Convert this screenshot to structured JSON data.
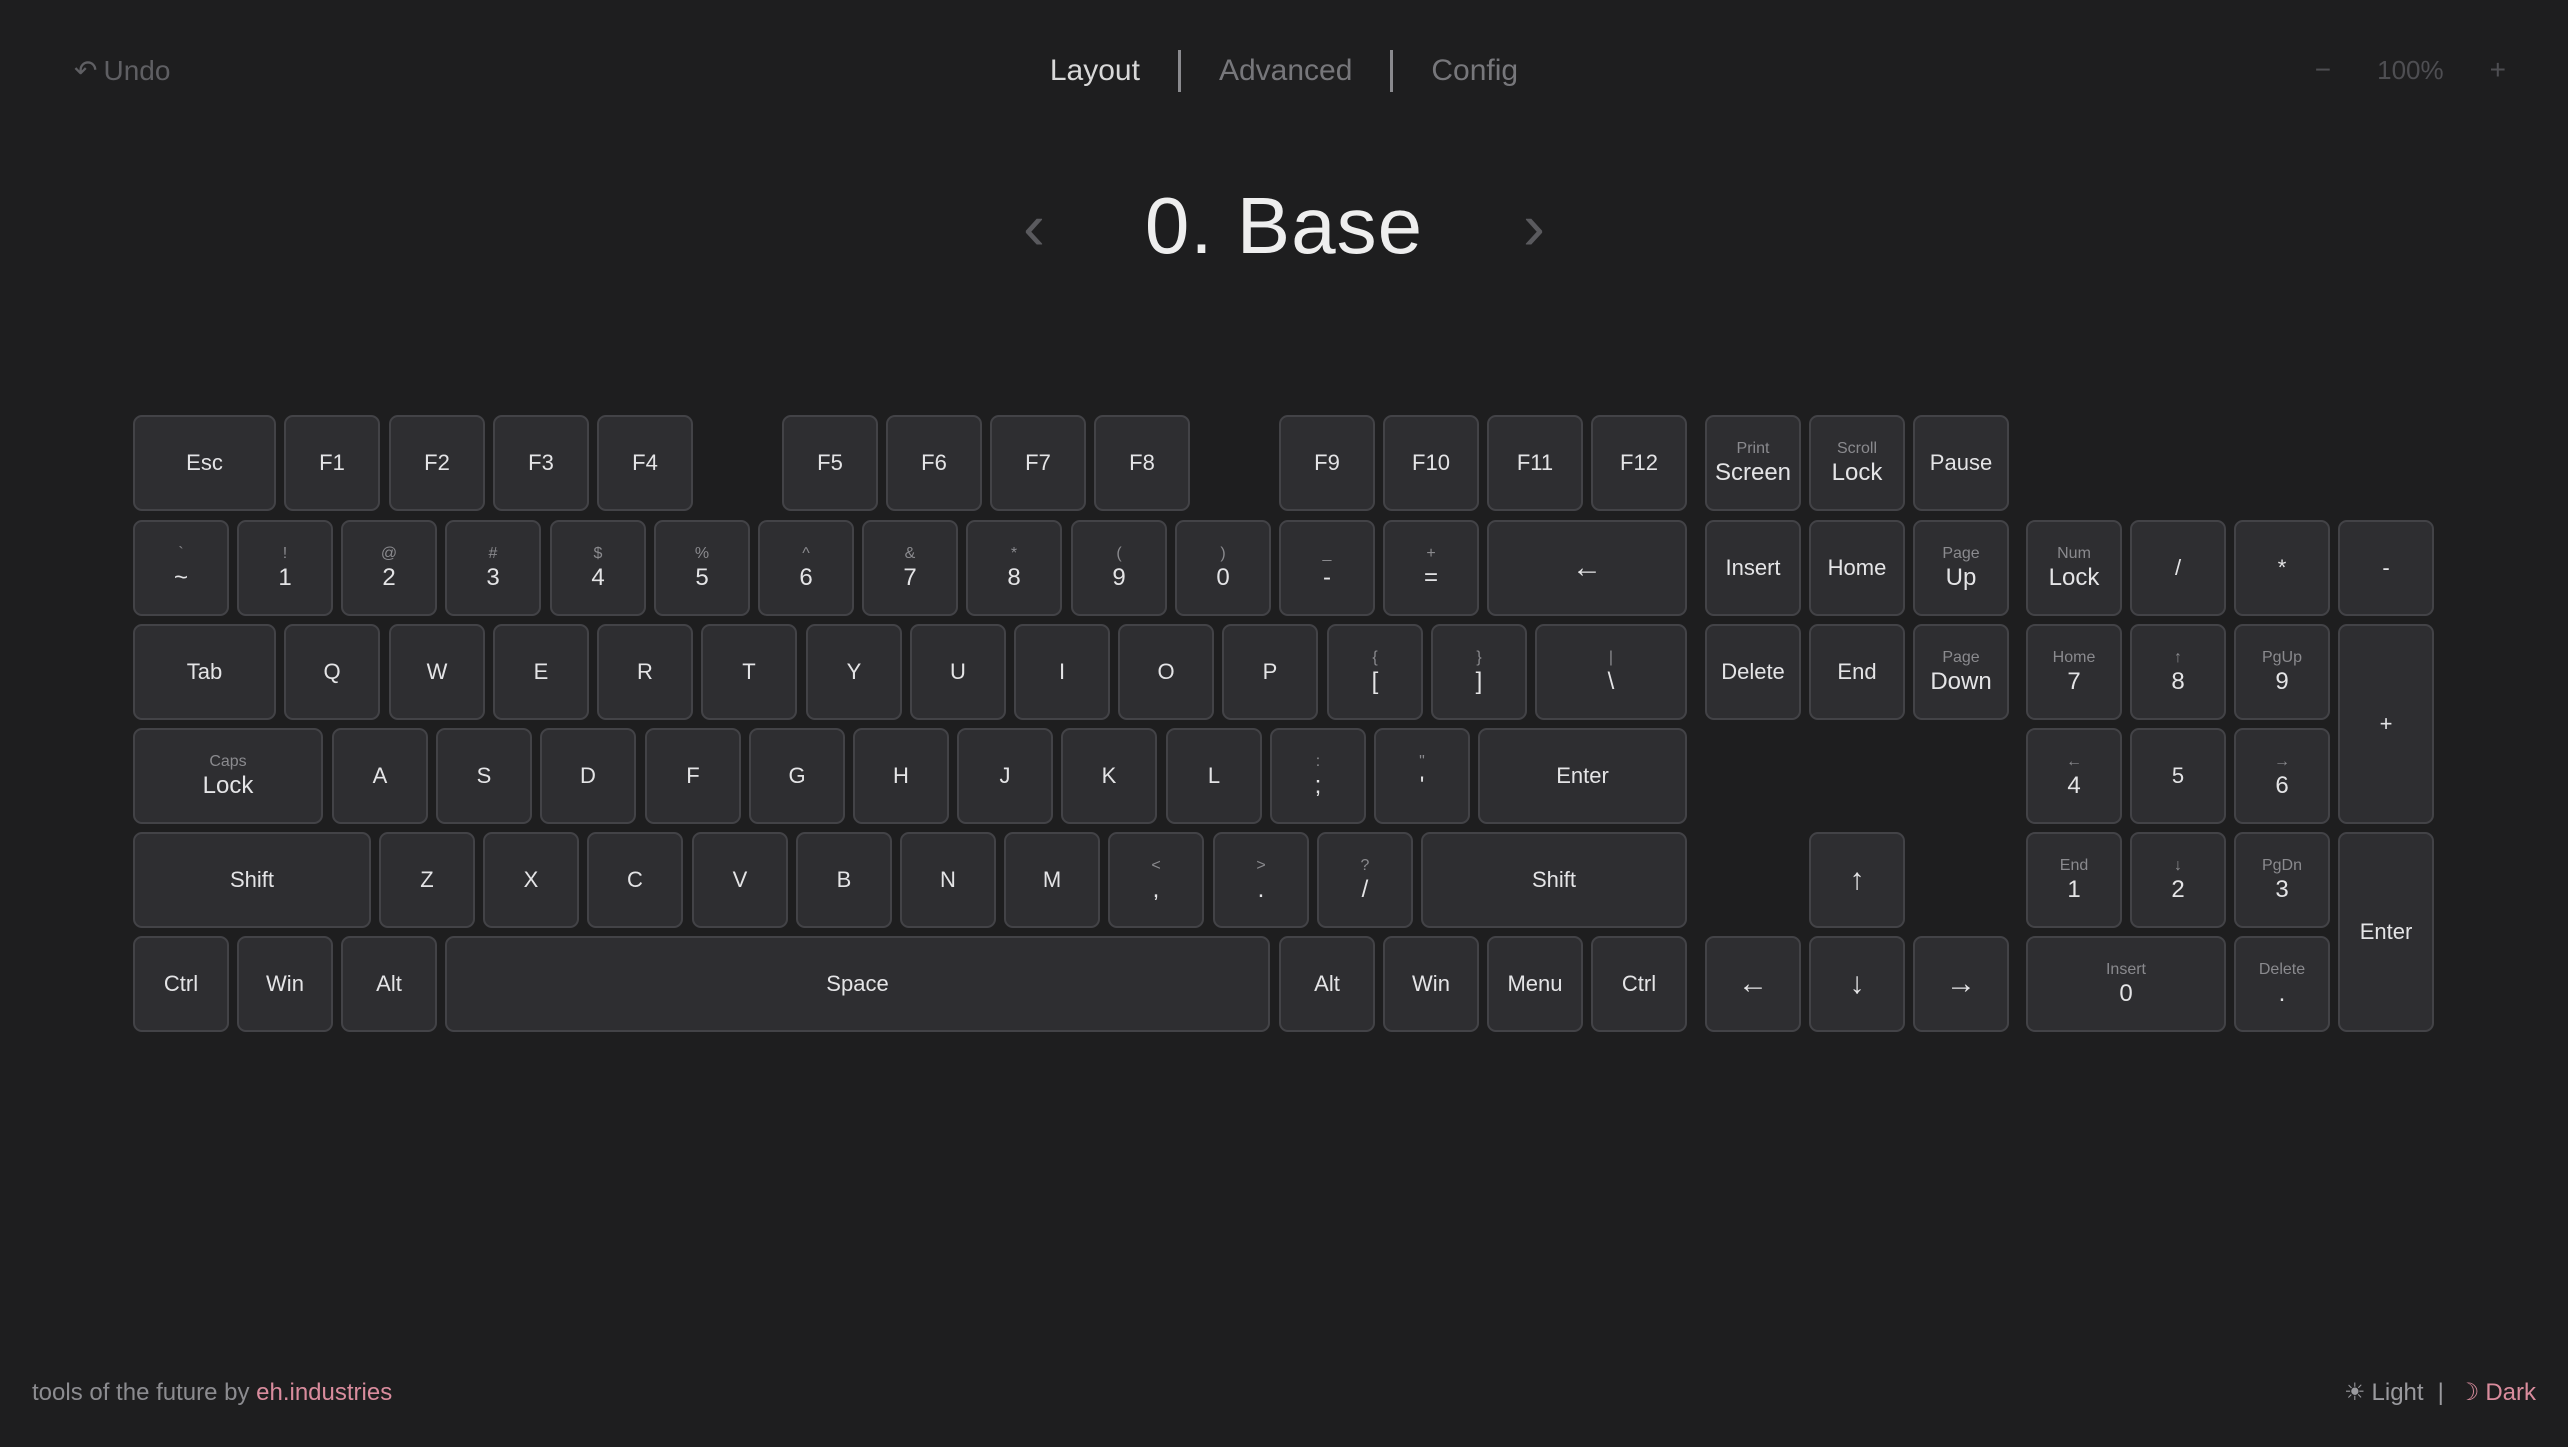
{
  "header": {
    "undo_icon": "↶",
    "undo_label": "Undo",
    "tabs": [
      {
        "label": "Layout",
        "active": true
      },
      {
        "label": "Advanced",
        "active": false
      },
      {
        "label": "Config",
        "active": false
      }
    ],
    "zoom": {
      "minus": "−",
      "value": "100%",
      "plus": "+"
    }
  },
  "layer": {
    "prev": "‹",
    "title": "0. Base",
    "next": "›"
  },
  "keyboard": {
    "keys": [
      {
        "main": "Esc"
      },
      {
        "main": "F1"
      },
      {
        "main": "F2"
      },
      {
        "main": "F3"
      },
      {
        "main": "F4"
      },
      {
        "main": "F5"
      },
      {
        "main": "F6"
      },
      {
        "main": "F7"
      },
      {
        "main": "F8"
      },
      {
        "main": "F9"
      },
      {
        "main": "F10"
      },
      {
        "main": "F11"
      },
      {
        "main": "F12"
      },
      {
        "sub": "Print",
        "main": "Screen"
      },
      {
        "sub": "Scroll",
        "main": "Lock"
      },
      {
        "main": "Pause"
      },
      {
        "sub": "`",
        "main": "~"
      },
      {
        "sub": "!",
        "main": "1"
      },
      {
        "sub": "@",
        "main": "2"
      },
      {
        "sub": "#",
        "main": "3"
      },
      {
        "sub": "$",
        "main": "4"
      },
      {
        "sub": "%",
        "main": "5"
      },
      {
        "sub": "^",
        "main": "6"
      },
      {
        "sub": "&",
        "main": "7"
      },
      {
        "sub": "*",
        "main": "8"
      },
      {
        "sub": "(",
        "main": "9"
      },
      {
        "sub": ")",
        "main": "0"
      },
      {
        "sub": "_",
        "main": "-"
      },
      {
        "sub": "+",
        "main": "="
      },
      {
        "main": "←",
        "arrow": true
      },
      {
        "main": "Insert"
      },
      {
        "main": "Home"
      },
      {
        "sub": "Page",
        "main": "Up"
      },
      {
        "sub": "Num",
        "main": "Lock"
      },
      {
        "main": "/"
      },
      {
        "main": "*"
      },
      {
        "main": "-"
      },
      {
        "main": "Tab"
      },
      {
        "main": "Q"
      },
      {
        "main": "W"
      },
      {
        "main": "E"
      },
      {
        "main": "R"
      },
      {
        "main": "T"
      },
      {
        "main": "Y"
      },
      {
        "main": "U"
      },
      {
        "main": "I"
      },
      {
        "main": "O"
      },
      {
        "main": "P"
      },
      {
        "sub": "{",
        "main": "["
      },
      {
        "sub": "}",
        "main": "]"
      },
      {
        "sub": "|",
        "main": "\\"
      },
      {
        "main": "Delete"
      },
      {
        "main": "End"
      },
      {
        "sub": "Page",
        "main": "Down"
      },
      {
        "sub": "Home",
        "main": "7"
      },
      {
        "sub": "↑",
        "main": "8"
      },
      {
        "sub": "PgUp",
        "main": "9"
      },
      {
        "main": "+"
      },
      {
        "sub": "Caps",
        "main": "Lock"
      },
      {
        "main": "A"
      },
      {
        "main": "S"
      },
      {
        "main": "D"
      },
      {
        "main": "F"
      },
      {
        "main": "G"
      },
      {
        "main": "H"
      },
      {
        "main": "J"
      },
      {
        "main": "K"
      },
      {
        "main": "L"
      },
      {
        "sub": ":",
        "main": ";"
      },
      {
        "sub": "\"",
        "main": "'"
      },
      {
        "main": "Enter"
      },
      {
        "sub": "←",
        "main": "4"
      },
      {
        "main": "5"
      },
      {
        "sub": "→",
        "main": "6"
      },
      {
        "main": "Shift"
      },
      {
        "main": "Z"
      },
      {
        "main": "X"
      },
      {
        "main": "C"
      },
      {
        "main": "V"
      },
      {
        "main": "B"
      },
      {
        "main": "N"
      },
      {
        "main": "M"
      },
      {
        "sub": "<",
        "main": ","
      },
      {
        "sub": ">",
        "main": "."
      },
      {
        "sub": "?",
        "main": "/"
      },
      {
        "main": "Shift"
      },
      {
        "main": "↑",
        "arrow": true
      },
      {
        "sub": "End",
        "main": "1"
      },
      {
        "sub": "↓",
        "main": "2"
      },
      {
        "sub": "PgDn",
        "main": "3"
      },
      {
        "main": "Enter"
      },
      {
        "main": "Ctrl"
      },
      {
        "main": "Win"
      },
      {
        "main": "Alt"
      },
      {
        "main": "Space"
      },
      {
        "main": "Alt"
      },
      {
        "main": "Win"
      },
      {
        "main": "Menu"
      },
      {
        "main": "Ctrl"
      },
      {
        "main": "←",
        "arrow": true
      },
      {
        "main": "↓",
        "arrow": true
      },
      {
        "main": "→",
        "arrow": true
      },
      {
        "sub": "Insert",
        "main": "0"
      },
      {
        "sub": "Delete",
        "main": "."
      }
    ]
  },
  "footer": {
    "text": "tools of the future by ",
    "link": "eh.industries"
  },
  "theme": {
    "light_icon": "☀",
    "light_label": "Light",
    "divider": "|",
    "dark_icon": "☽",
    "dark_label": "Dark"
  }
}
